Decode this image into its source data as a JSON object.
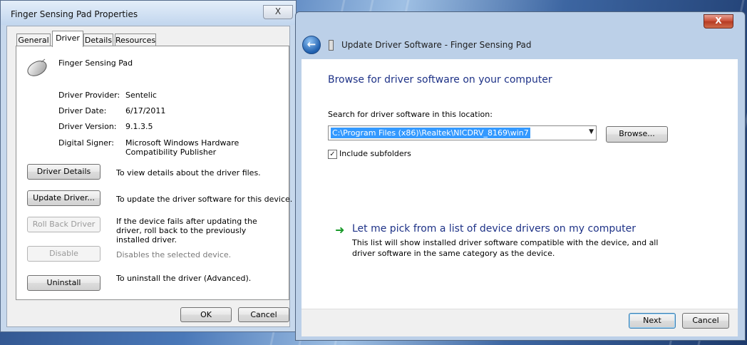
{
  "props_window": {
    "title": "Finger Sensing Pad Properties",
    "tabs": [
      "General",
      "Driver",
      "Details",
      "Resources"
    ],
    "device_name": "Finger Sensing Pad",
    "fields": [
      {
        "label": "Driver Provider:",
        "value": "Sentelic"
      },
      {
        "label": "Driver Date:",
        "value": "6/17/2011"
      },
      {
        "label": "Driver Version:",
        "value": "9.1.3.5"
      },
      {
        "label": "Digital Signer:",
        "value": "Microsoft Windows Hardware Compatibility Publisher"
      }
    ],
    "actions": [
      {
        "button": "Driver Details",
        "desc": "To view details about the driver files.",
        "enabled": true
      },
      {
        "button": "Update Driver...",
        "desc": "To update the driver software for this device.",
        "enabled": true
      },
      {
        "button": "Roll Back Driver",
        "desc": "If the device fails after updating the driver, roll back to the previously installed driver.",
        "enabled": false
      },
      {
        "button": "Disable",
        "desc": "Disables the selected device.",
        "enabled": false
      },
      {
        "button": "Uninstall",
        "desc": "To uninstall the driver (Advanced).",
        "enabled": true
      }
    ],
    "ok_label": "OK",
    "cancel_label": "Cancel",
    "close_glyph": "X"
  },
  "update_window": {
    "title": "Update Driver Software - Finger Sensing Pad",
    "heading": "Browse for driver software on your computer",
    "search_label": "Search for driver software in this location:",
    "path_value": "C:\\Program Files (x86)\\Realtek\\NICDRV_8169\\win7",
    "browse_label": "Browse...",
    "include_subfolders_label": "Include subfolders",
    "include_subfolders_checked": true,
    "pick_heading": "Let me pick from a list of device drivers on my computer",
    "pick_desc": "This list will show installed driver software compatible with the device, and all driver software in the same category as the device.",
    "next_label": "Next",
    "cancel_label": "Cancel",
    "close_glyph": "X"
  },
  "colors": {
    "link_blue": "#1e3287",
    "selection": "#3399ff",
    "arrow_green": "#1a9a2a"
  }
}
